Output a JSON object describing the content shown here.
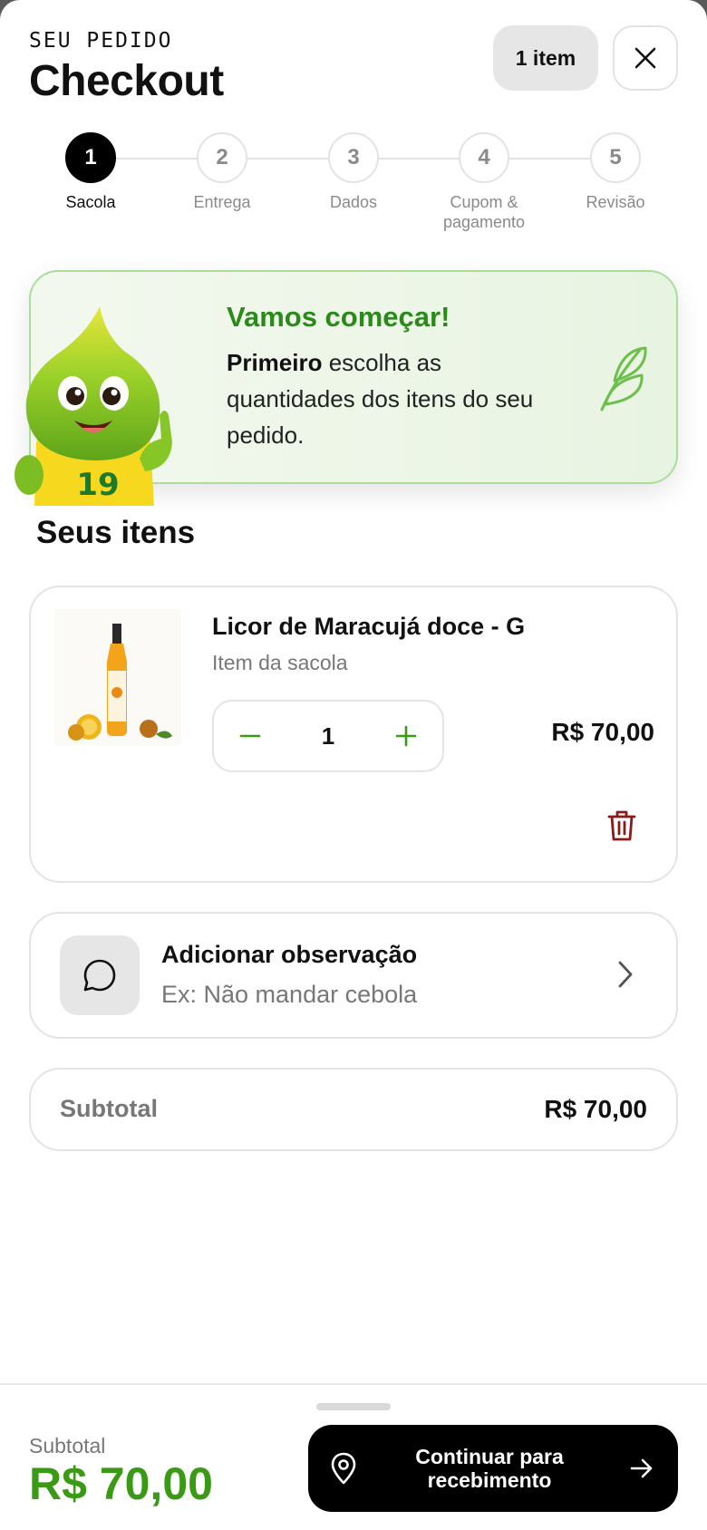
{
  "header": {
    "kicker": "SEU PEDIDO",
    "title": "Checkout",
    "items_count": "1 item"
  },
  "steps": [
    {
      "number": "1",
      "label": "Sacola",
      "active": true
    },
    {
      "number": "2",
      "label": "Entrega",
      "active": false
    },
    {
      "number": "3",
      "label": "Dados",
      "active": false
    },
    {
      "number": "4",
      "label": "Cupom & pagamento",
      "active": false
    },
    {
      "number": "5",
      "label": "Revisão",
      "active": false
    }
  ],
  "hero": {
    "title": "Vamos começar!",
    "bold": "Primeiro",
    "text": " escolha as quantidades dos itens do seu pedido.",
    "mascot_number": "19"
  },
  "section": {
    "title": "Seus itens"
  },
  "item": {
    "name": "Licor de Maracujá doce - G",
    "subtitle": "Item da sacola",
    "quantity": "1",
    "price": "R$ 70,00"
  },
  "note": {
    "title": "Adicionar observação",
    "placeholder": "Ex: Não mandar cebola"
  },
  "subtotal": {
    "label": "Subtotal",
    "value": "R$ 70,00"
  },
  "footer": {
    "label": "Subtotal",
    "total": "R$ 70,00",
    "cta": "Continuar para\nrecebimento"
  },
  "colors": {
    "accent_green": "#3a9a15",
    "hero_title": "#2a8a1a",
    "trash_red": "#8b1a1a"
  }
}
